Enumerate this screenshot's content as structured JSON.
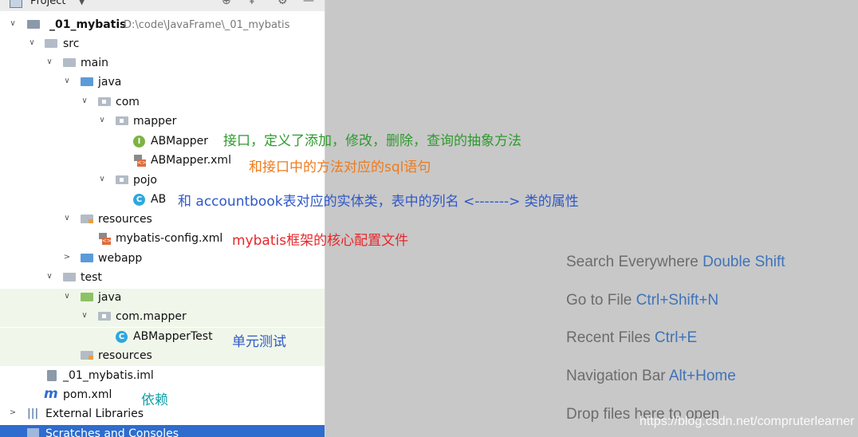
{
  "header": {
    "title": "Project"
  },
  "tree": {
    "root_name": "_01_mybatis",
    "root_path": "D:\\code\\JavaFrame\\_01_mybatis",
    "src": "src",
    "main": "main",
    "java": "java",
    "com": "com",
    "mapper": "mapper",
    "abmapper": "ABMapper",
    "abmapper_xml": "ABMapper.xml",
    "pojo": "pojo",
    "ab": "AB",
    "resources": "resources",
    "mybatis_config": "mybatis-config.xml",
    "webapp": "webapp",
    "test": "test",
    "test_java": "java",
    "com_mapper": "com.mapper",
    "abmapper_test": "ABMapperTest",
    "test_resources": "resources",
    "iml": "_01_mybatis.iml",
    "pom": "pom.xml",
    "external_libraries": "External Libraries",
    "scratches": "Scratches and Consoles"
  },
  "annotations": {
    "abmapper": "接口，定义了添加，修改，删除，查询的抽象方法",
    "abmapper_xml": "和接口中的方法对应的sql语句",
    "ab": "和 accountbook表对应的实体类，表中的列名 <-------> 类的属性",
    "mybatis_config": "mybatis框架的核心配置文件",
    "abmapper_test": "单元测试",
    "pom": "依赖"
  },
  "hints": [
    {
      "text": "Search Everywhere",
      "shortcut": "Double Shift"
    },
    {
      "text": "Go to File",
      "shortcut": "Ctrl+Shift+N"
    },
    {
      "text": "Recent Files",
      "shortcut": "Ctrl+E"
    },
    {
      "text": "Navigation Bar",
      "shortcut": "Alt+Home"
    },
    {
      "text": "Drop files here to open",
      "shortcut": ""
    }
  ],
  "watermark": "https://blog.csdn.net/compruterlearner",
  "colors": {
    "annotation_green": "#2f9a2f",
    "annotation_orange": "#ef7a1a",
    "annotation_blue": "#2f58c8",
    "annotation_red": "#e8262a",
    "annotation_teal": "#13a0a8",
    "selection": "#2e6ccd"
  }
}
